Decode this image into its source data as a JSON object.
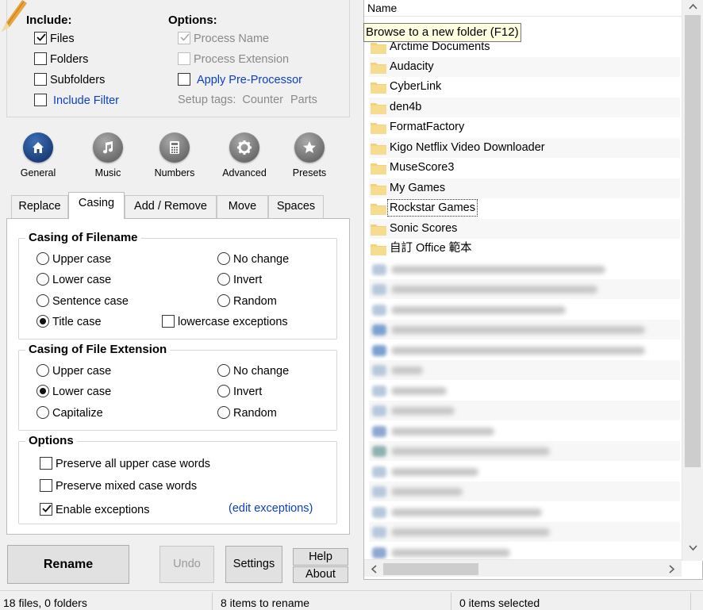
{
  "include": {
    "title": "Include:",
    "files": "Files",
    "folders": "Folders",
    "subfolders": "Subfolders",
    "include_filter": "Include Filter"
  },
  "options_top": {
    "title": "Options:",
    "process_name": "Process Name",
    "process_extension": "Process Extension",
    "apply_preprocessor": "Apply Pre-Processor",
    "setup_tags": "Setup tags:",
    "counter": "Counter",
    "parts": "Parts"
  },
  "categories": [
    {
      "label": "General",
      "icon": "home-icon"
    },
    {
      "label": "Music",
      "icon": "music-note-icon"
    },
    {
      "label": "Numbers",
      "icon": "calculator-icon"
    },
    {
      "label": "Advanced",
      "icon": "gear-icon"
    },
    {
      "label": "Presets",
      "icon": "star-icon"
    }
  ],
  "tabs": [
    "Replace",
    "Casing",
    "Add / Remove",
    "Move",
    "Spaces"
  ],
  "casing_filename": {
    "title": "Casing of Filename",
    "upper": "Upper case",
    "no_change": "No change",
    "lower": "Lower case",
    "invert": "Invert",
    "sentence": "Sentence case",
    "random": "Random",
    "title_case": "Title case",
    "lowercase_exceptions": "lowercase exceptions"
  },
  "casing_extension": {
    "title": "Casing of File Extension",
    "upper": "Upper case",
    "no_change": "No change",
    "lower": "Lower case",
    "invert": "Invert",
    "capitalize": "Capitalize",
    "random": "Random"
  },
  "options": {
    "title": "Options",
    "preserve_upper": "Preserve all upper case words",
    "preserve_mixed": "Preserve mixed case words",
    "enable_exceptions": "Enable exceptions",
    "edit_exceptions": "(edit exceptions)"
  },
  "buttons": {
    "rename": "Rename",
    "undo": "Undo",
    "settings": "Settings",
    "help": "Help",
    "about": "About"
  },
  "file_list": {
    "column": "Name",
    "tooltip": "Browse to a new folder (F12)",
    "items": [
      "Arctime Documents",
      "Audacity",
      "CyberLink",
      "den4b",
      "FormatFactory",
      "Kigo Netflix Video Downloader",
      "MuseScore3",
      "My Games",
      "Rockstar Games",
      "Sonic Scores",
      "自訂 Office 範本"
    ]
  },
  "status": {
    "counts": "18 files, 0 folders",
    "to_rename": "8 items to rename",
    "selected": "0 items selected"
  },
  "colors": {
    "accent_blue": "#0a3fc8",
    "active_icon": "#1b3f7a",
    "folder": "#f3d27a",
    "tooltip_bg": "#ffffe1"
  }
}
